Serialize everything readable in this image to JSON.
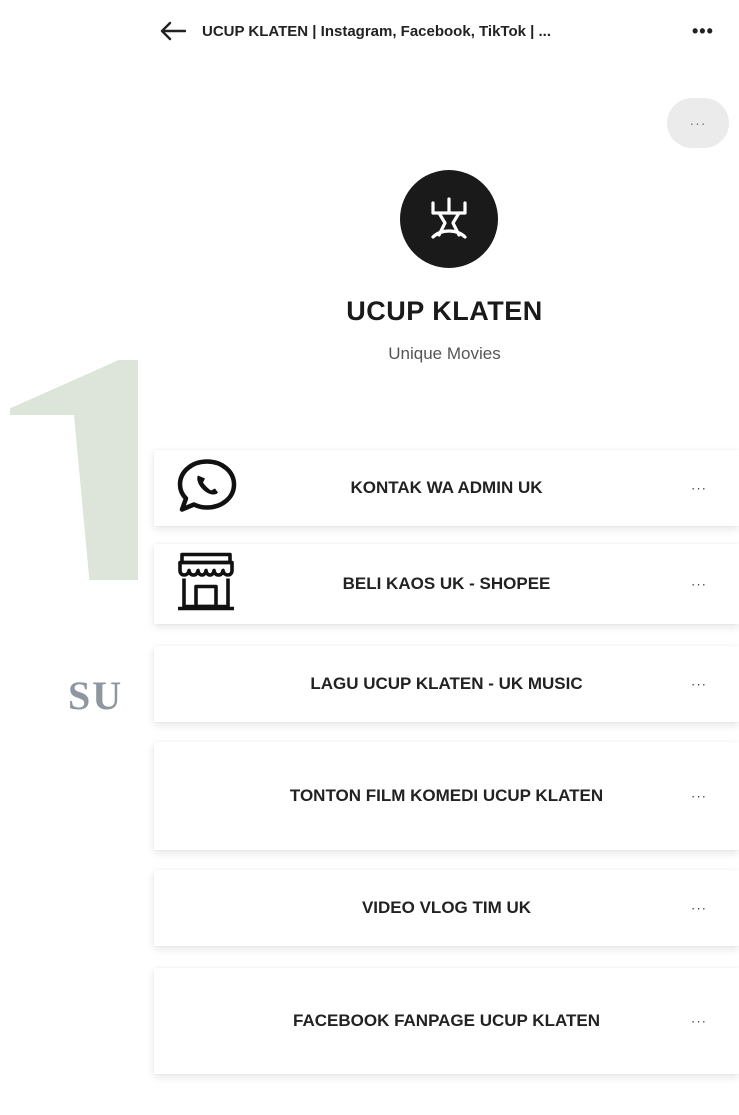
{
  "watermark": {
    "text": "SU"
  },
  "header": {
    "title": "UCUP KLATEN | Instagram, Facebook, TikTok | ...",
    "more_label": "•••"
  },
  "profile": {
    "share_label": "···",
    "name": "UCUP KLATEN",
    "bio": "Unique Movies"
  },
  "links": [
    {
      "label": "KONTAK WA ADMIN UK",
      "icon": "whatsapp-icon",
      "more": "···"
    },
    {
      "label": "BELI KAOS UK - SHOPEE",
      "icon": "store-icon",
      "more": "···"
    },
    {
      "label": "LAGU UCUP KLATEN - UK MUSIC",
      "icon": "",
      "more": "···"
    },
    {
      "label": "TONTON FILM KOMEDI UCUP KLATEN",
      "icon": "",
      "more": "···"
    },
    {
      "label": "VIDEO VLOG TIM UK",
      "icon": "",
      "more": "···"
    },
    {
      "label": "FACEBOOK FANPAGE UCUP KLATEN",
      "icon": "",
      "more": "···"
    }
  ]
}
